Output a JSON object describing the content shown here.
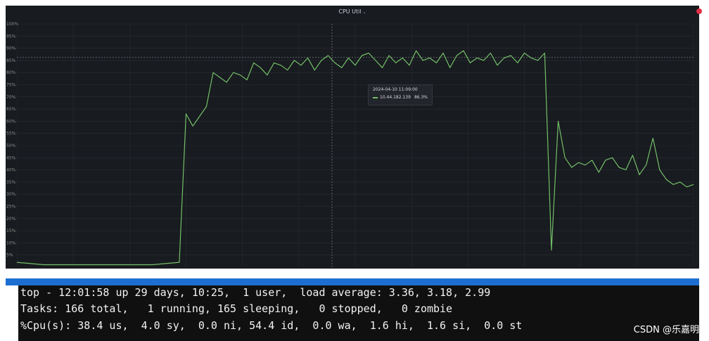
{
  "panel": {
    "title": "CPU Util",
    "chevron": "⌄",
    "y_ticks": [
      "5%",
      "10%",
      "15%",
      "20%",
      "25%",
      "30%",
      "35%",
      "40%",
      "45%",
      "50%",
      "55%",
      "60%",
      "65%",
      "70%",
      "75%",
      "80%",
      "85%",
      "90%",
      "95%",
      "100%"
    ]
  },
  "tooltip": {
    "time": "2024-04-10 11:09:00",
    "series": "10.44.182.139",
    "value": "86.3%"
  },
  "chart_data": {
    "type": "line",
    "title": "CPU Util",
    "ylim": [
      0,
      100
    ],
    "grid": true,
    "colors": {
      "line": "#73bf69",
      "background": "#181b1f",
      "grid": "#2b2f36"
    },
    "series": [
      {
        "name": "10.44.182.139",
        "x": [
          0,
          4,
          8,
          12,
          16,
          20,
          24,
          25,
          26,
          27,
          28,
          29,
          30,
          31,
          32,
          33,
          34,
          35,
          36,
          37,
          38,
          39,
          40,
          41,
          42,
          43,
          44,
          45,
          46,
          47,
          48,
          49,
          50,
          51,
          52,
          53,
          54,
          55,
          56,
          57,
          58,
          59,
          60,
          61,
          62,
          63,
          64,
          65,
          66,
          67,
          68,
          69,
          70,
          71,
          72,
          73,
          74,
          75,
          76,
          77,
          78,
          79,
          80,
          81,
          82,
          83,
          84,
          85,
          86,
          87,
          88,
          89,
          90,
          91,
          92,
          93,
          94,
          95,
          96,
          97,
          98,
          99,
          100
        ],
        "values": [
          2,
          1,
          1,
          1,
          1,
          1,
          2,
          63,
          58,
          62,
          66,
          80,
          78,
          76,
          80,
          79,
          77,
          84,
          82,
          79,
          84,
          83,
          81,
          85,
          83,
          86,
          81,
          85,
          87,
          84,
          82,
          86,
          83,
          87,
          88,
          85,
          82,
          87,
          84,
          86,
          83,
          89,
          85,
          86,
          84,
          88,
          82,
          87,
          89,
          84,
          86,
          85,
          88,
          83,
          86,
          87,
          84,
          88,
          86,
          85,
          88,
          7,
          60,
          45,
          41,
          43,
          42,
          44,
          39,
          44,
          45,
          41,
          40,
          46,
          38,
          42,
          53,
          40,
          36,
          34,
          35,
          33,
          34
        ]
      }
    ],
    "hover": {
      "time": "2024-04-10 11:09:00",
      "value": "86.3%"
    }
  },
  "terminal": {
    "lines": [
      "top - 12:01:58 up 29 days, 10:25,  1 user,  load average: 3.36, 3.18, 2.99",
      "Tasks: 166 total,   1 running, 165 sleeping,   0 stopped,   0 zombie",
      "%Cpu(s): 38.4 us,  4.0 sy,  0.0 ni, 54.4 id,  0.0 wa,  1.6 hi,  1.6 si,  0.0 st"
    ]
  },
  "watermark": "CSDN @乐嘉明"
}
